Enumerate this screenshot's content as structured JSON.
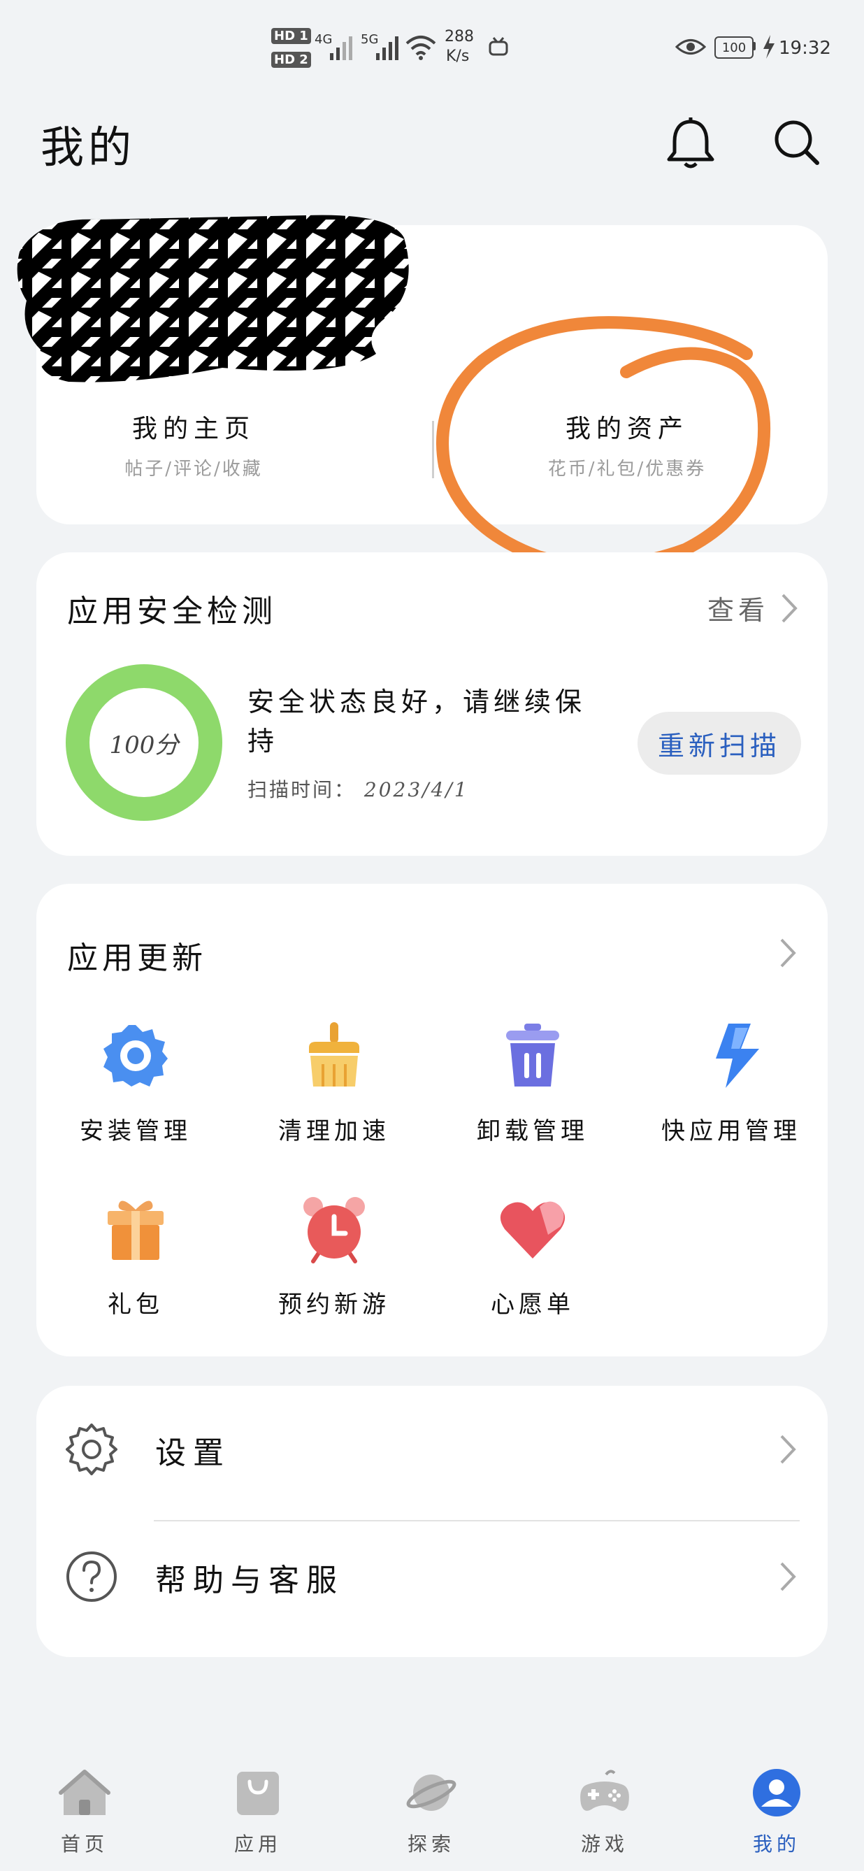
{
  "status_bar": {
    "hd1": "HD 1",
    "hd2": "HD 2",
    "net1": "4G",
    "net2": "5G",
    "speed_value": "288",
    "speed_unit": "K/s",
    "battery": "100",
    "time": "19:32"
  },
  "header": {
    "title": "我的",
    "bell_icon": "bell-icon",
    "search_icon": "search-icon"
  },
  "profile": {
    "home_title": "我的主页",
    "home_sub": "帖子/评论/收藏",
    "assets_title": "我的资产",
    "assets_sub": "花币/礼包/优惠券"
  },
  "security": {
    "title": "应用安全检测",
    "view_label": "查看",
    "score_label": "100分",
    "score": 100,
    "status_line1": "安全状态良好，请继续保",
    "status_line2": "持",
    "scan_time_label": "扫描时间：",
    "scan_time": "2023/4/1",
    "rescan_label": "重新扫描"
  },
  "updates": {
    "title": "应用更新",
    "items": [
      {
        "label": "安装管理",
        "icon": "install-gear-icon"
      },
      {
        "label": "清理加速",
        "icon": "broom-icon"
      },
      {
        "label": "卸载管理",
        "icon": "trash-icon"
      },
      {
        "label": "快应用管理",
        "icon": "lightning-icon"
      },
      {
        "label": "礼包",
        "icon": "gift-icon"
      },
      {
        "label": "预约新游",
        "icon": "alarm-clock-icon"
      },
      {
        "label": "心愿单",
        "icon": "heart-icon"
      }
    ]
  },
  "settings": {
    "settings_label": "设置",
    "help_label": "帮助与客服"
  },
  "nav": {
    "items": [
      {
        "label": "首页",
        "icon": "home-icon"
      },
      {
        "label": "应用",
        "icon": "bag-icon"
      },
      {
        "label": "探索",
        "icon": "planet-icon"
      },
      {
        "label": "游戏",
        "icon": "gamepad-icon"
      },
      {
        "label": "我的",
        "icon": "profile-icon"
      }
    ],
    "active": "我的"
  },
  "colors": {
    "accent": "#2a5fbf",
    "ring": "#8ed96b",
    "annotation": "#f0873a",
    "background": "#f1f3f5"
  }
}
